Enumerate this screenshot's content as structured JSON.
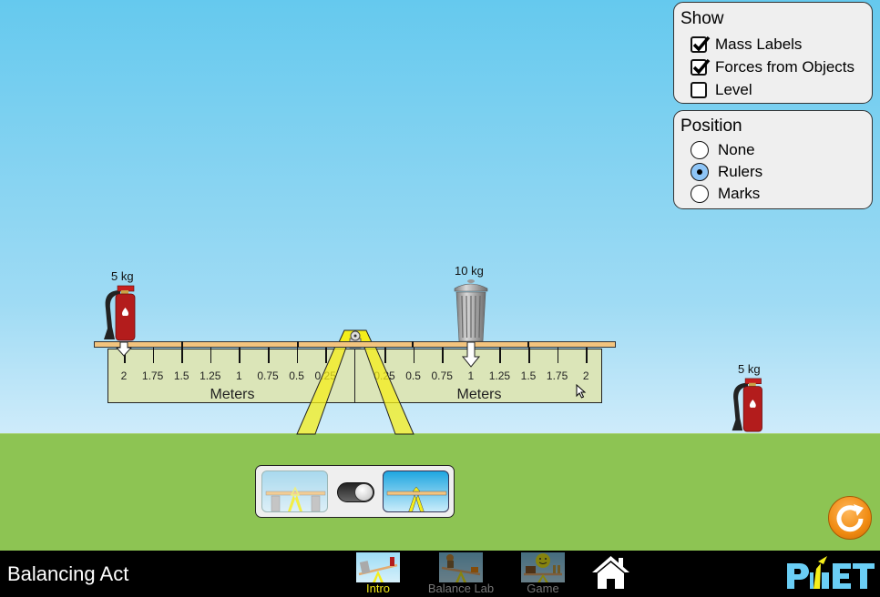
{
  "app": {
    "title": "Balancing Act"
  },
  "show_panel": {
    "title": "Show",
    "options": [
      {
        "label": "Mass Labels",
        "checked": true
      },
      {
        "label": "Forces from Objects",
        "checked": true
      },
      {
        "label": "Level",
        "checked": false
      }
    ]
  },
  "position_panel": {
    "title": "Position",
    "options": [
      {
        "label": "None",
        "selected": false
      },
      {
        "label": "Rulers",
        "selected": true
      },
      {
        "label": "Marks",
        "selected": false
      }
    ]
  },
  "masses": [
    {
      "name": "fire-extinguisher",
      "label": "5 kg",
      "on_plank": true,
      "position_m": -2
    },
    {
      "name": "trash-can",
      "label": "10 kg",
      "on_plank": true,
      "position_m": 1
    },
    {
      "name": "fire-extinguisher",
      "label": "5 kg",
      "on_plank": false
    }
  ],
  "rulers": {
    "left": {
      "ticks": [
        "2",
        "1.75",
        "1.5",
        "1.25",
        "1",
        "0.75",
        "0.5",
        "0.25"
      ],
      "unit": "Meters"
    },
    "right": {
      "ticks": [
        "0.25",
        "0.5",
        "0.75",
        "1",
        "1.25",
        "1.5",
        "1.75",
        "2"
      ],
      "unit": "Meters"
    }
  },
  "support_mode": {
    "options": [
      "supports-on",
      "supports-off"
    ],
    "selected": "supports-off"
  },
  "nav": {
    "tabs": [
      {
        "label": "Intro",
        "active": true
      },
      {
        "label": "Balance Lab",
        "active": false
      },
      {
        "label": "Game",
        "active": false
      }
    ],
    "brand": "PhET"
  },
  "colors": {
    "sky_top": "#65c9ee",
    "ground": "#8dc453",
    "plank": "#f3c47e",
    "fulcrum": "#f5ee1a",
    "ruler": "#dbe5b8",
    "active_tab": "#f2e916",
    "reset": "#f08b12",
    "phet_blue": "#6acef5"
  }
}
